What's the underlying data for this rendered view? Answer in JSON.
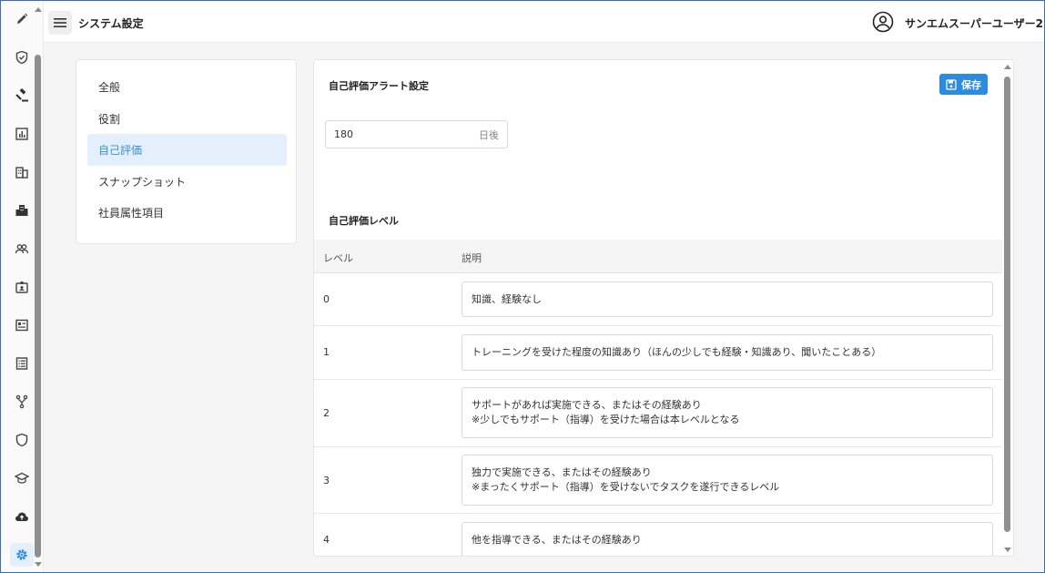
{
  "header": {
    "title": "システム設定",
    "user_name": "サンエムスーパーユーザー2"
  },
  "rail": {
    "icons": [
      "pencil-icon",
      "shield-check-icon",
      "gavel-icon",
      "chart-icon",
      "building-icon",
      "city-icon",
      "users-icon",
      "id-card-icon",
      "list-card-icon",
      "document-list-icon",
      "fork-icon",
      "shield-icon",
      "graduation-cap-icon",
      "cloud-upload-icon",
      "gear-icon"
    ],
    "active": "gear-icon"
  },
  "settings_menu": {
    "items": [
      {
        "label": "全般"
      },
      {
        "label": "役割"
      },
      {
        "label": "自己評価"
      },
      {
        "label": "スナップショット"
      },
      {
        "label": "社員属性項目"
      }
    ],
    "active_index": 2
  },
  "alert_section": {
    "title": "自己評価アラート設定",
    "save_label": "保存",
    "days_value": "180",
    "days_unit": "日後"
  },
  "level_section": {
    "title": "自己評価レベル",
    "columns": [
      "レベル",
      "説明"
    ],
    "rows": [
      {
        "level": "0",
        "lines": [
          "知識、経験なし"
        ]
      },
      {
        "level": "1",
        "lines": [
          "トレーニングを受けた程度の知識あり（ほんの少しでも経験・知識あり、聞いたことある）"
        ]
      },
      {
        "level": "2",
        "lines": [
          "サポートがあれば実施できる、またはその経験あり",
          "※少しでもサポート（指導）を受けた場合は本レベルとなる"
        ]
      },
      {
        "level": "3",
        "lines": [
          "独力で実施できる、またはその経験あり",
          "※まったくサポート（指導）を受けないでタスクを遂行できるレベル"
        ]
      },
      {
        "level": "4",
        "lines": [
          "他を指導できる、またはその経験あり"
        ]
      }
    ]
  },
  "colors": {
    "accent": "#2b8be0",
    "active_bg": "#e3f0fb",
    "active_text": "#3b8fdc"
  }
}
